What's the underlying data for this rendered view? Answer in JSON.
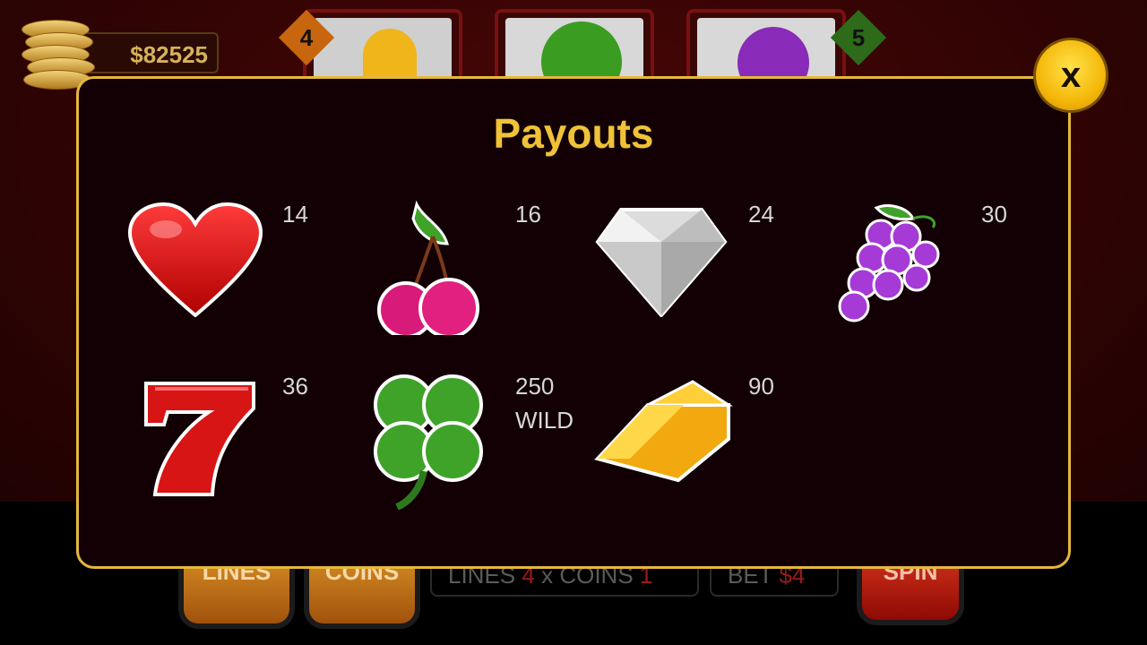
{
  "hud": {
    "balance": "$82525",
    "line_badges": [
      "4",
      "5"
    ]
  },
  "bottom": {
    "lines_button": "LINES",
    "coins_button": "COINS",
    "lines_label": "LINES",
    "lines_value": "4",
    "times": "x",
    "coins_label": "COINS",
    "coins_value": "1",
    "bet_label": "BET",
    "bet_value": "$4",
    "spin_button": "SPIN"
  },
  "modal": {
    "title": "Payouts",
    "close_label": "x",
    "items": [
      {
        "symbol": "heart",
        "value": "14",
        "label": ""
      },
      {
        "symbol": "cherry",
        "value": "16",
        "label": ""
      },
      {
        "symbol": "diamond",
        "value": "24",
        "label": ""
      },
      {
        "symbol": "grapes",
        "value": "30",
        "label": ""
      },
      {
        "symbol": "seven",
        "value": "36",
        "label": ""
      },
      {
        "symbol": "clover",
        "value": "250",
        "label": "WILD"
      },
      {
        "symbol": "gold-bar",
        "value": "90",
        "label": ""
      }
    ]
  },
  "colors": {
    "accent_gold": "#f0c238",
    "modal_border": "#e5b83a",
    "modal_bg": "#120004"
  }
}
